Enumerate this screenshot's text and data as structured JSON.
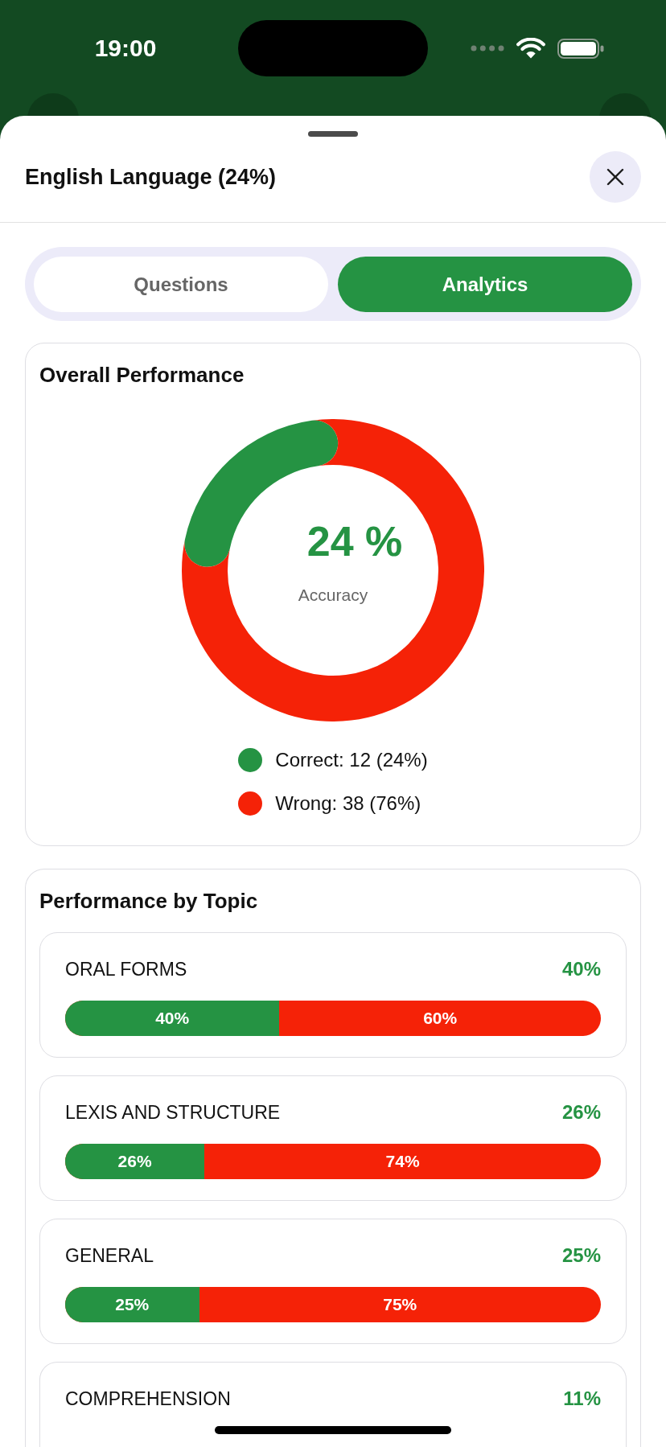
{
  "status_bar": {
    "time": "19:00"
  },
  "sheet": {
    "title": "English Language (24%)"
  },
  "tabs": [
    {
      "label": "Questions",
      "selected": false
    },
    {
      "label": "Analytics",
      "selected": true
    }
  ],
  "overall": {
    "title": "Overall Performance",
    "center_value": "24 %",
    "center_label": "Accuracy",
    "chart_data": {
      "type": "donut",
      "categories": [
        "Correct",
        "Wrong"
      ],
      "values": [
        24,
        76
      ]
    },
    "legend": [
      {
        "detail": ": 12 (24%)",
        "color": "#259343"
      },
      {
        "detail": ": 38 (76%)",
        "color": "#f52207"
      }
    ]
  },
  "topics": {
    "title": "Performance by Topic",
    "items": [
      {
        "name": "ORAL FORMS",
        "percent": "40%",
        "level": 0.4,
        "correct_label": "40%",
        "wrong_label": "60%"
      },
      {
        "name": "LEXIS AND STRUCTURE",
        "percent": "26%",
        "level": 0.26,
        "correct_label": "26%",
        "wrong_label": "74%"
      },
      {
        "name": "GENERAL",
        "percent": "25%",
        "level": 0.25,
        "correct_label": "25%",
        "wrong_label": "75%"
      },
      {
        "name": "COMPREHENSION",
        "percent": "11%"
      }
    ]
  }
}
